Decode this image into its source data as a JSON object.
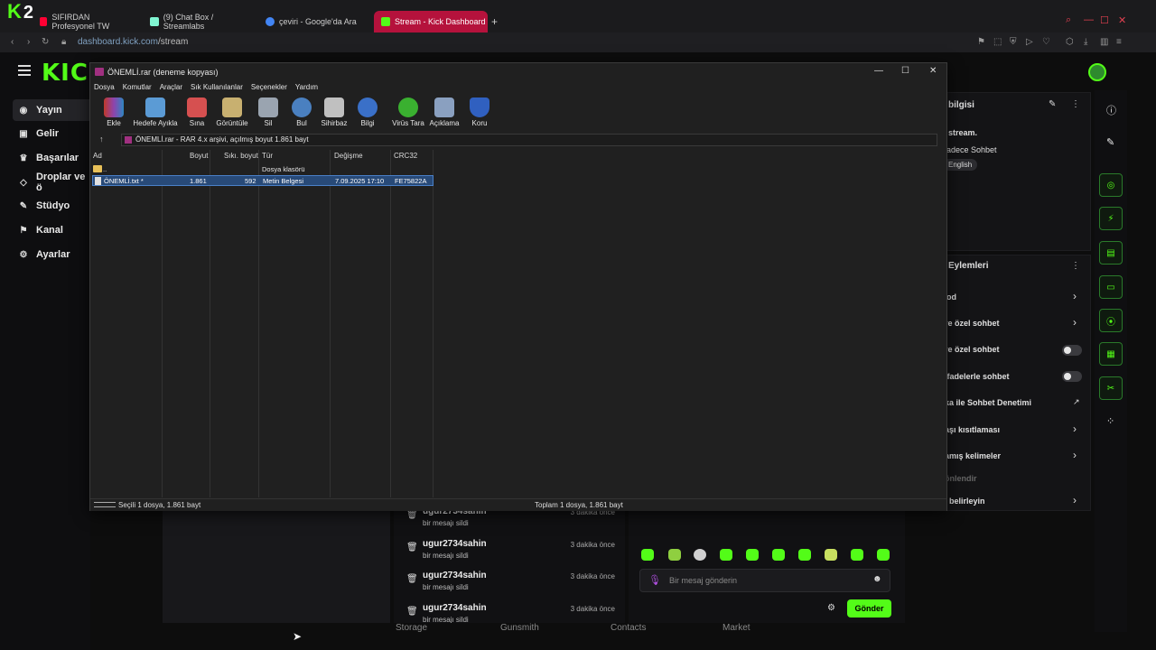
{
  "browser": {
    "tabs": [
      {
        "label": "SIFIRDAN Profesyonel TW",
        "favicon_color": "#ff0033"
      },
      {
        "label": "(9) Chat Box / Streamlabs",
        "favicon_color": "#80f5d2"
      },
      {
        "label": "çeviri - Google'da Ara",
        "favicon_color": "#4285f4"
      },
      {
        "label": "Stream - Kick Dashboard",
        "favicon_color": "#53fc18"
      }
    ],
    "url_domain": "dashboard.kick.com",
    "url_path": "/stream"
  },
  "overlay_badge": "2",
  "kick": {
    "logo": "KICK",
    "nav": [
      "Yayın",
      "Gelir",
      "Başarılar",
      "Droplar ve ö",
      "Stüdyo",
      "Kanal",
      "Ayarlar"
    ],
    "stream_info": {
      "title": "bilgisi",
      "line1": "stream.",
      "line2": "adece Sohbet",
      "badge": "English"
    },
    "actions": {
      "title": "Eylemleri",
      "items": [
        {
          "label": "od",
          "control": "chevron"
        },
        {
          "label": "re özel sohbet",
          "control": "chevron"
        },
        {
          "label": "re özel sohbet",
          "control": "toggle"
        },
        {
          "label": "ifadelerle sohbet",
          "control": "toggle"
        },
        {
          "label": "ka ile Sohbet Denetimi",
          "control": "external"
        },
        {
          "label": "aşı kısıtlaması",
          "control": "chevron"
        },
        {
          "label": "amış kelimeler",
          "control": "chevron"
        },
        {
          "label": "önlendir",
          "control": "none"
        },
        {
          "label": "i belirleyin",
          "control": "chevron"
        }
      ]
    },
    "chat": {
      "rows": [
        {
          "user": "ugur2734sahin",
          "msg": "bir mesajı sildi",
          "time": "3 dakika önce"
        },
        {
          "user": "ugur2734sahin",
          "msg": "bir mesajı sildi",
          "time": "3 dakika önce"
        },
        {
          "user": "ugur2734sahin",
          "msg": "bir mesajı sildi",
          "time": "3 dakika önce"
        },
        {
          "user": "ugur2734sahin",
          "msg": "bir mesajı sildi",
          "time": "3 dakika önce"
        }
      ],
      "input_placeholder": "Bir mesaj gönderin",
      "send_label": "Gönder"
    },
    "bottom_labels": [
      "Storage",
      "Gunsmith",
      "Contacts",
      "Market"
    ]
  },
  "winrar": {
    "title": "ÖNEMLİ.rar (deneme kopyası)",
    "menu": [
      "Dosya",
      "Komutlar",
      "Araçlar",
      "Sık Kullanılanlar",
      "Seçenekler",
      "Yardım"
    ],
    "toolbar": [
      {
        "label": "Ekle",
        "icon": "add-archive-icon",
        "color": "#c0392b"
      },
      {
        "label": "Hedefe Ayıkla",
        "icon": "extract-folder-icon",
        "color": "#5b9bd5"
      },
      {
        "label": "Sına",
        "icon": "test-clipboard-icon",
        "color": "#d65050"
      },
      {
        "label": "Görüntüle",
        "icon": "view-book-icon",
        "color": "#c8b070"
      },
      {
        "label": "Sil",
        "icon": "trash-icon",
        "color": "#9aa4b0"
      },
      {
        "label": "Bul",
        "icon": "magnifier-icon",
        "color": "#4a80c0"
      },
      {
        "label": "Sihirbaz",
        "icon": "wand-icon",
        "color": "#c0c0c0"
      },
      {
        "label": "Bilgi",
        "icon": "info-icon",
        "color": "#3a70c8"
      },
      {
        "label": "Virüs Tara",
        "icon": "virus-scan-icon",
        "color": "#3ab030"
      },
      {
        "label": "Açıklama",
        "icon": "comment-icon",
        "color": "#8aa0c0"
      },
      {
        "label": "Koru",
        "icon": "shield-icon",
        "color": "#3060c0"
      }
    ],
    "path": "ÖNEMLİ.rar - RAR 4.x arşivi, açılmış boyut 1.861 bayt",
    "columns": [
      "Ad",
      "Boyut",
      "Sıkı. boyut",
      "Tür",
      "Değişme",
      "CRC32"
    ],
    "rows": [
      {
        "name": "..",
        "size": "",
        "packed": "",
        "type": "Dosya klasörü",
        "modified": "",
        "crc": ""
      },
      {
        "name": "ÖNEMLİ.txt *",
        "size": "1.861",
        "packed": "592",
        "type": "Metin Belgesi",
        "modified": "7.09.2025 17:10",
        "crc": "FE75822A"
      }
    ],
    "status_left": "Seçili 1 dosya, 1.861 bayt",
    "status_right": "Toplam 1 dosya, 1.861 bayt"
  }
}
